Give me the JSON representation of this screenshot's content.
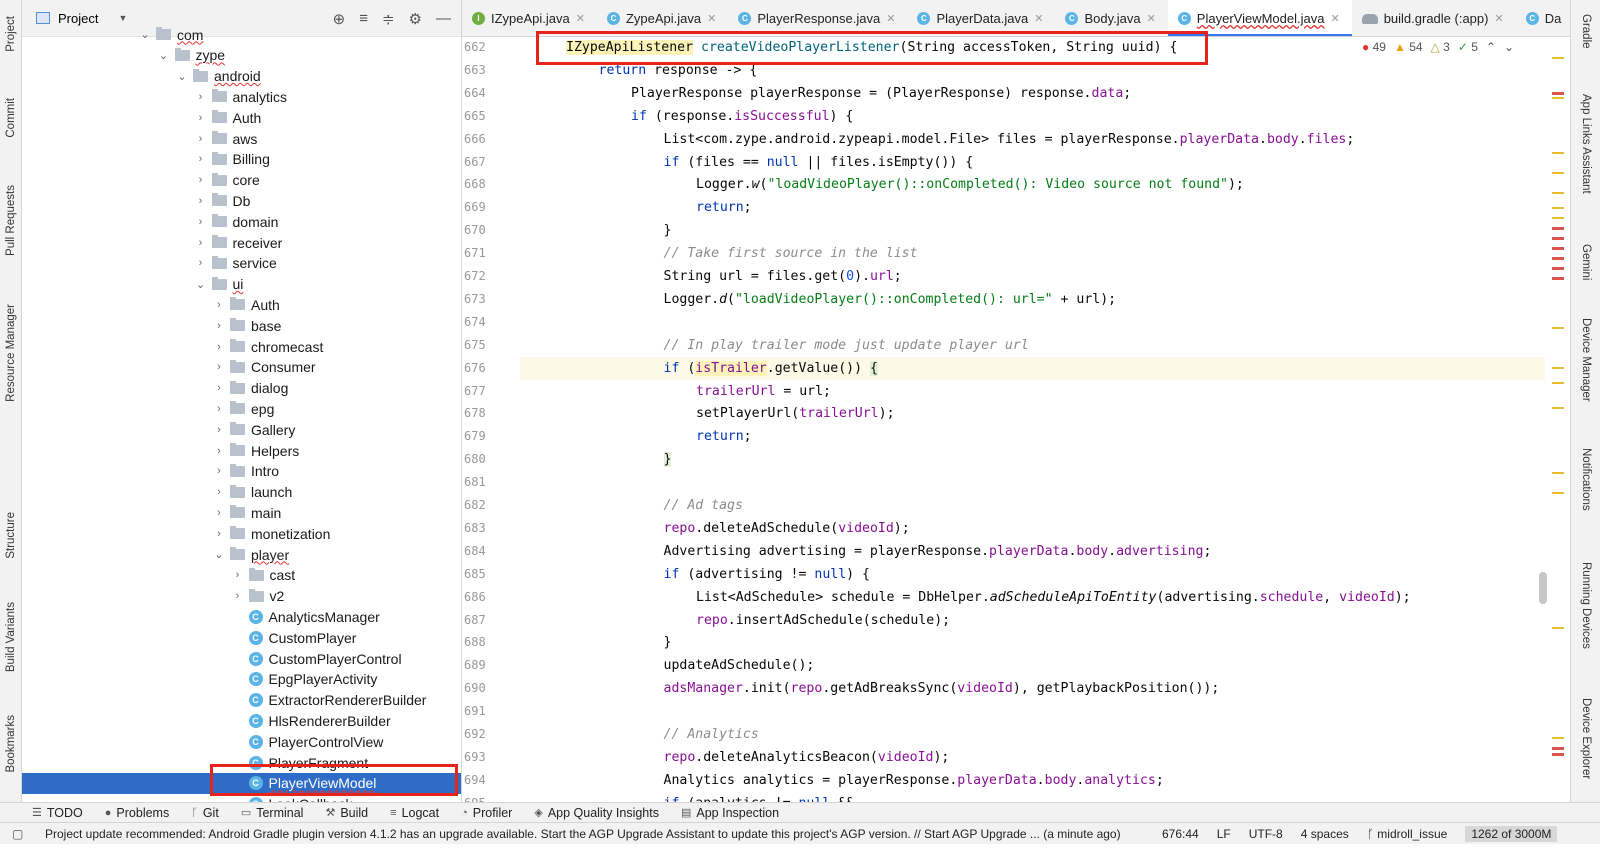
{
  "left_strip": [
    "Project",
    "Commit",
    "Pull Requests",
    "Resource Manager",
    "Structure",
    "Build Variants",
    "Bookmarks"
  ],
  "right_strip": [
    "Gradle",
    "App Links Assistant",
    "Gemini",
    "Device Manager",
    "Notifications",
    "Running Devices",
    "Device Explorer"
  ],
  "project": {
    "title": "Project",
    "tree": [
      {
        "depth": 6,
        "type": "folder",
        "label": "com",
        "open": true,
        "partial": true
      },
      {
        "depth": 7,
        "type": "folder",
        "label": "zype",
        "open": true
      },
      {
        "depth": 8,
        "type": "folder",
        "label": "android",
        "open": true
      },
      {
        "depth": 9,
        "type": "folder",
        "label": "analytics"
      },
      {
        "depth": 9,
        "type": "folder",
        "label": "Auth"
      },
      {
        "depth": 9,
        "type": "folder",
        "label": "aws"
      },
      {
        "depth": 9,
        "type": "folder",
        "label": "Billing"
      },
      {
        "depth": 9,
        "type": "folder",
        "label": "core"
      },
      {
        "depth": 9,
        "type": "folder",
        "label": "Db"
      },
      {
        "depth": 9,
        "type": "folder",
        "label": "domain"
      },
      {
        "depth": 9,
        "type": "folder",
        "label": "receiver"
      },
      {
        "depth": 9,
        "type": "folder",
        "label": "service"
      },
      {
        "depth": 9,
        "type": "folder",
        "label": "ui",
        "open": true
      },
      {
        "depth": 10,
        "type": "folder",
        "label": "Auth"
      },
      {
        "depth": 10,
        "type": "folder",
        "label": "base"
      },
      {
        "depth": 10,
        "type": "folder",
        "label": "chromecast"
      },
      {
        "depth": 10,
        "type": "folder",
        "label": "Consumer"
      },
      {
        "depth": 10,
        "type": "folder",
        "label": "dialog"
      },
      {
        "depth": 10,
        "type": "folder",
        "label": "epg"
      },
      {
        "depth": 10,
        "type": "folder",
        "label": "Gallery"
      },
      {
        "depth": 10,
        "type": "folder",
        "label": "Helpers"
      },
      {
        "depth": 10,
        "type": "folder",
        "label": "Intro"
      },
      {
        "depth": 10,
        "type": "folder",
        "label": "launch"
      },
      {
        "depth": 10,
        "type": "folder",
        "label": "main"
      },
      {
        "depth": 10,
        "type": "folder",
        "label": "monetization"
      },
      {
        "depth": 10,
        "type": "folder",
        "label": "player",
        "open": true
      },
      {
        "depth": 11,
        "type": "folder",
        "label": "cast"
      },
      {
        "depth": 11,
        "type": "folder",
        "label": "v2"
      },
      {
        "depth": 11,
        "type": "class",
        "label": "AnalyticsManager"
      },
      {
        "depth": 11,
        "type": "class",
        "label": "CustomPlayer"
      },
      {
        "depth": 11,
        "type": "class",
        "label": "CustomPlayerControl"
      },
      {
        "depth": 11,
        "type": "class",
        "label": "EpgPlayerActivity"
      },
      {
        "depth": 11,
        "type": "class",
        "label": "ExtractorRendererBuilder"
      },
      {
        "depth": 11,
        "type": "class",
        "label": "HlsRendererBuilder"
      },
      {
        "depth": 11,
        "type": "class",
        "label": "PlayerControlView"
      },
      {
        "depth": 11,
        "type": "class",
        "label": "PlayerFragment"
      },
      {
        "depth": 11,
        "type": "class",
        "label": "PlayerViewModel",
        "selected": true
      },
      {
        "depth": 11,
        "type": "class",
        "label": "LookCallback",
        "partial": true
      }
    ]
  },
  "tabs": [
    {
      "label": "IZypeApi.java",
      "icon": "i"
    },
    {
      "label": "ZypeApi.java",
      "icon": "c"
    },
    {
      "label": "PlayerResponse.java",
      "icon": "c"
    },
    {
      "label": "PlayerData.java",
      "icon": "c"
    },
    {
      "label": "Body.java",
      "icon": "c"
    },
    {
      "label": "PlayerViewModel.java",
      "icon": "c",
      "active": true
    },
    {
      "label": "build.gradle (:app)",
      "icon": "g"
    },
    {
      "label": "Da",
      "icon": "c"
    }
  ],
  "inspections": {
    "errors": "49",
    "warnings": "54",
    "weak": "3",
    "ok": "5"
  },
  "code": {
    "lines": [
      {
        "n": "662",
        "indent": 0,
        "html": "<span class=\"hlw\">IZypeApiListener</span> <span class=\"num\" style=\"color:#00627a\">createVideoPlayerListener</span>(String accessToken, String uuid) {"
      },
      {
        "n": "663",
        "indent": 1,
        "html": "<span class=\"kw\">return</span> response -&gt; {"
      },
      {
        "n": "664",
        "indent": 2,
        "html": "PlayerResponse playerResponse = (PlayerResponse) response.<span class=\"fld\">data</span>;"
      },
      {
        "n": "665",
        "indent": 2,
        "html": "<span class=\"kw\">if</span> (response.<span class=\"fld\">isSuccessful</span>) {"
      },
      {
        "n": "666",
        "indent": 3,
        "html": "List&lt;com.zype.android.zypeapi.model.File&gt; files = playerResponse.<span class=\"fld\">playerData</span>.<span class=\"fld\">body</span>.<span class=\"fld\">files</span>;"
      },
      {
        "n": "667",
        "indent": 3,
        "html": "<span class=\"kw\">if</span> (files == <span class=\"kw\">null</span> || files.isEmpty()) {"
      },
      {
        "n": "668",
        "indent": 4,
        "html": "Logger.<span class=\"ital\">w</span>(<span class=\"str\">\"loadVideoPlayer()::onCompleted(): Video source not found\"</span>);"
      },
      {
        "n": "669",
        "indent": 4,
        "html": "<span class=\"kw\">return</span>;"
      },
      {
        "n": "670",
        "indent": 3,
        "html": "}"
      },
      {
        "n": "671",
        "indent": 3,
        "html": "<span class=\"cm\">// Take first source in the list</span>"
      },
      {
        "n": "672",
        "indent": 3,
        "html": "String url = files.get(<span class=\"num\">0</span>).<span class=\"fld\">url</span>;"
      },
      {
        "n": "673",
        "indent": 3,
        "html": "Logger.<span class=\"ital\">d</span>(<span class=\"str\">\"loadVideoPlayer()::onCompleted(): url=\"</span> + url);"
      },
      {
        "n": "674",
        "indent": 3,
        "html": ""
      },
      {
        "n": "675",
        "indent": 3,
        "html": "<span class=\"cm\">// In play trailer mode just update player url</span>"
      },
      {
        "n": "676",
        "indent": 3,
        "cur": true,
        "html": "<span class=\"kw\">if</span> (<span class=\"fld hlw\">isTrailer</span>.getValue()) <span class=\"brace\">{</span>"
      },
      {
        "n": "677",
        "indent": 4,
        "html": "<span class=\"fld\">trailerUrl</span> = url;"
      },
      {
        "n": "678",
        "indent": 4,
        "html": "setPlayerUrl(<span class=\"fld\">trailerUrl</span>);"
      },
      {
        "n": "679",
        "indent": 4,
        "html": "<span class=\"kw\">return</span>;"
      },
      {
        "n": "680",
        "indent": 3,
        "html": "<span class=\"brace\">}</span>"
      },
      {
        "n": "681",
        "indent": 3,
        "html": ""
      },
      {
        "n": "682",
        "indent": 3,
        "html": "<span class=\"cm\">// Ad tags</span>"
      },
      {
        "n": "683",
        "indent": 3,
        "html": "<span class=\"fld\">repo</span>.deleteAdSchedule(<span class=\"fld\">videoId</span>);"
      },
      {
        "n": "684",
        "indent": 3,
        "html": "Advertising advertising = playerResponse.<span class=\"fld\">playerData</span>.<span class=\"fld\">body</span>.<span class=\"fld\">advertising</span>;"
      },
      {
        "n": "685",
        "indent": 3,
        "html": "<span class=\"kw\">if</span> (advertising != <span class=\"kw\">null</span>) {"
      },
      {
        "n": "686",
        "indent": 4,
        "html": "List&lt;AdSchedule&gt; schedule = DbHelper.<span class=\"ital\">adScheduleApiToEntity</span>(advertising.<span class=\"fld\">schedule</span>, <span class=\"fld\">videoId</span>);"
      },
      {
        "n": "687",
        "indent": 4,
        "html": "<span class=\"fld\">repo</span>.insertAdSchedule(schedule);"
      },
      {
        "n": "688",
        "indent": 3,
        "html": "}"
      },
      {
        "n": "689",
        "indent": 3,
        "html": "updateAdSchedule();"
      },
      {
        "n": "690",
        "indent": 3,
        "html": "<span class=\"fld\">adsManager</span>.init(<span class=\"fld\">repo</span>.getAdBreaksSync(<span class=\"fld\">videoId</span>), getPlaybackPosition());"
      },
      {
        "n": "691",
        "indent": 3,
        "html": ""
      },
      {
        "n": "692",
        "indent": 3,
        "html": "<span class=\"cm\">// Analytics</span>"
      },
      {
        "n": "693",
        "indent": 3,
        "html": "<span class=\"fld\">repo</span>.deleteAnalyticsBeacon(<span class=\"fld\">videoId</span>);"
      },
      {
        "n": "694",
        "indent": 3,
        "html": "Analytics analytics = playerResponse.<span class=\"fld\">playerData</span>.<span class=\"fld\">body</span>.<span class=\"fld\">analytics</span>;"
      },
      {
        "n": "695",
        "indent": 3,
        "html": "<span class=\"kw\">if</span> (analytics != <span class=\"kw\">null</span> &amp;&amp;"
      }
    ]
  },
  "bottom_tools": [
    "TODO",
    "Problems",
    "Git",
    "Terminal",
    "Build",
    "Logcat",
    "Profiler",
    "App Quality Insights",
    "App Inspection"
  ],
  "status": {
    "message": "Project update recommended: Android Gradle plugin version 4.1.2 has an upgrade available. Start the AGP Upgrade Assistant to update this project's AGP version. // Start AGP Upgrade ... (a minute ago)",
    "position": "676:44",
    "line_sep": "LF",
    "encoding": "UTF-8",
    "indent": "4 spaces",
    "branch": "midroll_issue",
    "memory": "1262 of 3000M"
  }
}
